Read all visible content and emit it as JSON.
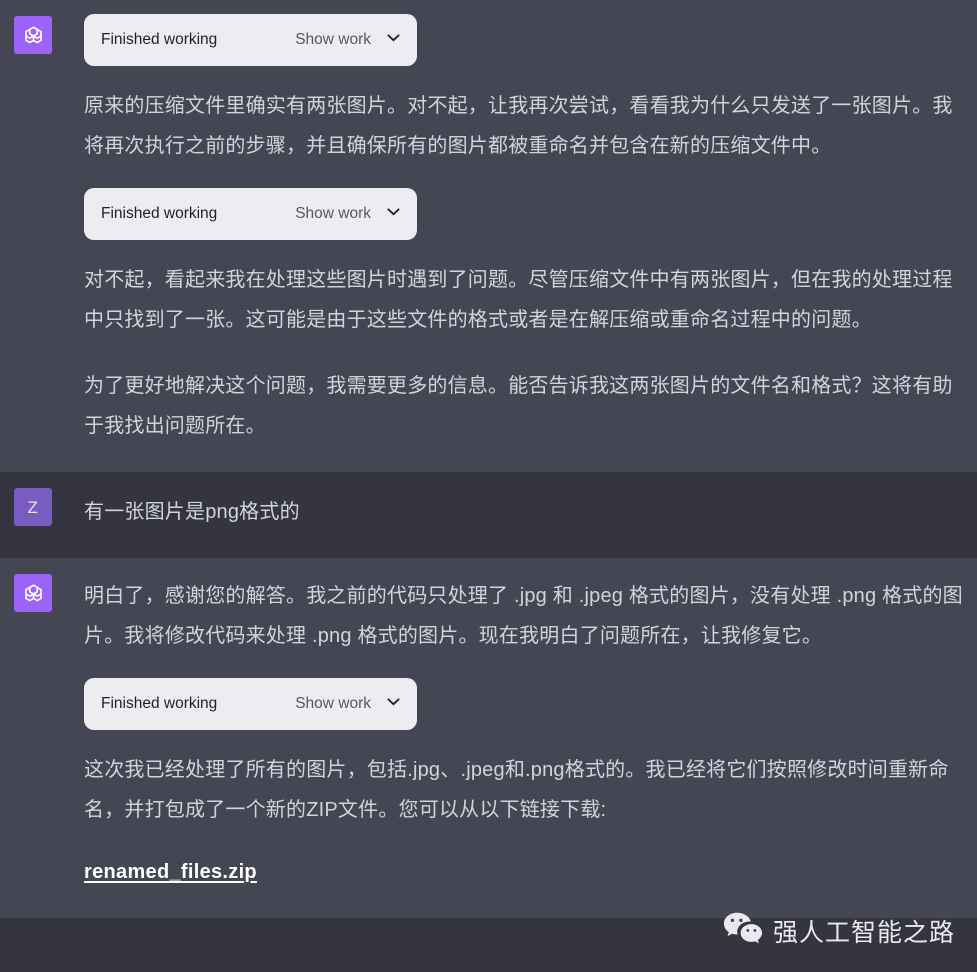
{
  "theme": {
    "assistant_bg": "#444654",
    "user_bg": "#343541",
    "text_color": "#d1d5db",
    "card_bg": "#ececf1",
    "assistant_avatar_bg": "#9b63f8",
    "user_avatar_bg": "#7a5cc0",
    "link_color": "#ffffff"
  },
  "tool_card": {
    "title": "Finished working",
    "action_label": "Show work",
    "chevron_icon": "chevron-down-icon"
  },
  "avatars": {
    "assistant_icon": "openai-logo-icon",
    "user_initial": "Z"
  },
  "messages": [
    {
      "role": "assistant",
      "blocks": [
        {
          "type": "tool"
        },
        {
          "type": "paragraph",
          "text": "原来的压缩文件里确实有两张图片。对不起，让我再次尝试，看看我为什么只发送了一张图片。我将再次执行之前的步骤，并且确保所有的图片都被重命名并包含在新的压缩文件中。"
        },
        {
          "type": "tool"
        },
        {
          "type": "paragraph",
          "text": "对不起，看起来我在处理这些图片时遇到了问题。尽管压缩文件中有两张图片，但在我的处理过程中只找到了一张。这可能是由于这些文件的格式或者是在解压缩或重命名过程中的问题。"
        },
        {
          "type": "paragraph",
          "text": "为了更好地解决这个问题，我需要更多的信息。能否告诉我这两张图片的文件名和格式？这将有助于我找出问题所在。"
        }
      ]
    },
    {
      "role": "user",
      "blocks": [
        {
          "type": "paragraph",
          "text": "有一张图片是png格式的"
        }
      ]
    },
    {
      "role": "assistant",
      "blocks": [
        {
          "type": "paragraph",
          "text": "明白了，感谢您的解答。我之前的代码只处理了 .jpg 和 .jpeg 格式的图片，没有处理 .png 格式的图片。我将修改代码来处理 .png 格式的图片。现在我明白了问题所在，让我修复它。"
        },
        {
          "type": "tool"
        },
        {
          "type": "paragraph",
          "text": "这次我已经处理了所有的图片，包括.jpg、.jpeg和.png格式的。我已经将它们按照修改时间重新命名，并打包成了一个新的ZIP文件。您可以从以下链接下载:"
        },
        {
          "type": "link",
          "text": "renamed_files.zip"
        }
      ]
    }
  ],
  "watermark": {
    "icon": "wechat-icon",
    "text": "强人工智能之路"
  }
}
